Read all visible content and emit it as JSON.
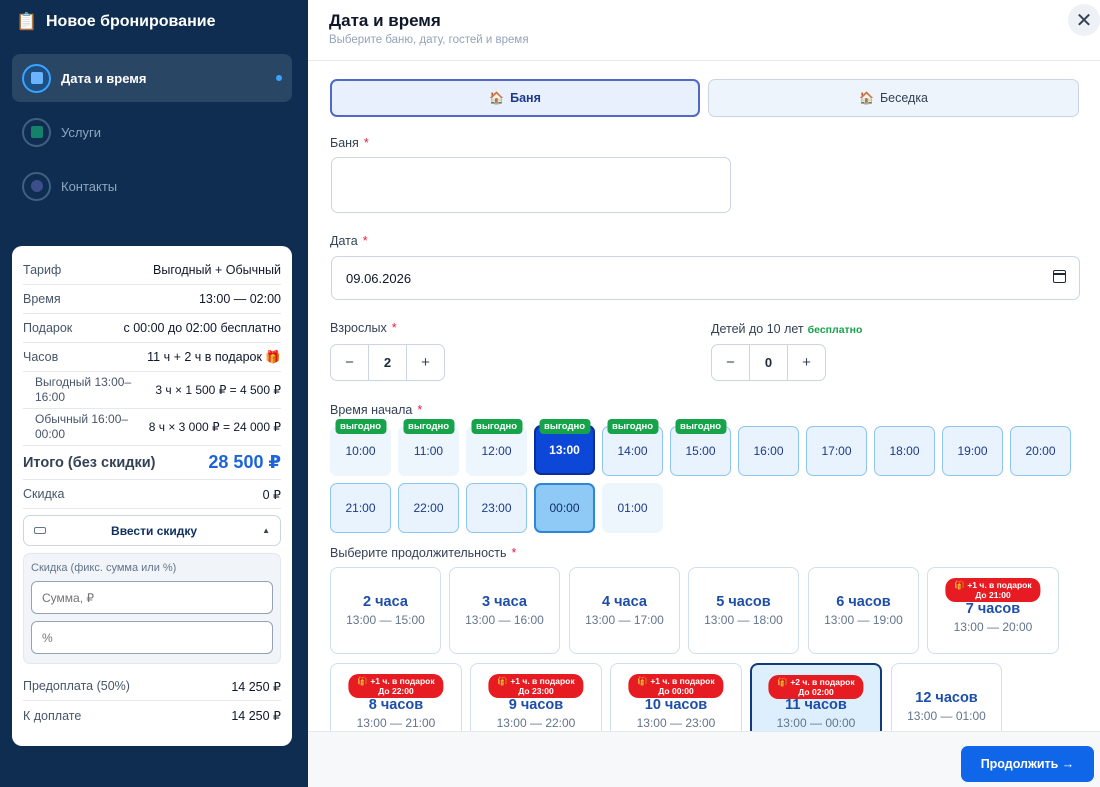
{
  "sidebar": {
    "title": "Новое бронирование",
    "steps": [
      {
        "label": "Дата и время"
      },
      {
        "label": "Услуги"
      },
      {
        "label": "Контакты"
      }
    ]
  },
  "summary": {
    "tariff_k": "Тариф",
    "tariff_v": "Выгодный + Обычный",
    "time_k": "Время",
    "time_v": "13:00 — 02:00",
    "gift_k": "Подарок",
    "gift_v": "с 00:00 до 02:00 бесплатно",
    "hours_k": "Часов",
    "hours_v": "11 ч + 2 ч в подарок 🎁",
    "line1_k": "Выгодный 13:00–16:00",
    "line1_v": "3 ч × 1 500 ₽ = 4 500 ₽",
    "line2_k": "Обычный 16:00–00:00",
    "line2_v": "8 ч × 3 000 ₽ = 24 000 ₽",
    "total_k": "Итого (без скидки)",
    "total_v": "28 500 ₽",
    "discount_k": "Скидка",
    "discount_v": "0 ₽",
    "discount_btn": "Ввести скидку",
    "discount_caption": "Скидка (фикс. сумма или %)",
    "sum_placeholder": "Сумма, ₽",
    "pct_placeholder": "%",
    "prepay_k": "Предоплата (50%)",
    "prepay_v": "14 250 ₽",
    "due_k": "К доплате",
    "due_v": "14 250 ₽"
  },
  "main": {
    "title": "Дата и время",
    "subtitle": "Выберите баню, дату, гостей и время",
    "type_bath": "Баня",
    "type_gazebo": "Беседка",
    "bath_label": "Баня",
    "date_label": "Дата",
    "date_value": "09.06.2026",
    "adults_label": "Взрослых",
    "adults_value": "2",
    "kids_label": "Детей до 10 лет",
    "kids_free": "бесплатно",
    "kids_value": "0",
    "start_label": "Время начала",
    "badge_text": "выгодно",
    "slots": [
      "10:00",
      "11:00",
      "12:00",
      "13:00",
      "14:00",
      "15:00",
      "16:00",
      "17:00",
      "18:00",
      "19:00",
      "20:00",
      "21:00",
      "22:00",
      "23:00",
      "00:00",
      "01:00"
    ],
    "duration_label": "Выберите продолжительность",
    "durations": [
      {
        "h": "2 часа",
        "r": "13:00 — 15:00"
      },
      {
        "h": "3 часа",
        "r": "13:00 — 16:00"
      },
      {
        "h": "4 часа",
        "r": "13:00 — 17:00"
      },
      {
        "h": "5 часов",
        "r": "13:00 — 18:00"
      },
      {
        "h": "6 часов",
        "r": "13:00 — 19:00"
      },
      {
        "h": "7 часов",
        "r": "13:00 — 20:00",
        "g1": "🎁 +1 ч. в подарок",
        "g2": "До 21:00"
      },
      {
        "h": "8 часов",
        "r": "13:00 — 21:00",
        "g1": "🎁 +1 ч. в подарок",
        "g2": "До 22:00"
      },
      {
        "h": "9 часов",
        "r": "13:00 — 22:00",
        "g1": "🎁 +1 ч. в подарок",
        "g2": "До 23:00"
      },
      {
        "h": "10 часов",
        "r": "13:00 — 23:00",
        "g1": "🎁 +1 ч. в подарок",
        "g2": "До 00:00"
      },
      {
        "h": "11 часов",
        "r": "13:00 — 00:00",
        "g1": "🎁 +2 ч. в подарок",
        "g2": "До 02:00"
      },
      {
        "h": "12 часов",
        "r": "13:00 — 01:00"
      }
    ],
    "next_btn": "Продолжить →"
  },
  "colors": {
    "sidebar": "#0e2d50",
    "accent": "#1066e8",
    "selected_slot": "#0d47d8",
    "badge_green": "#16a34a",
    "gift_red": "#e61c22"
  }
}
